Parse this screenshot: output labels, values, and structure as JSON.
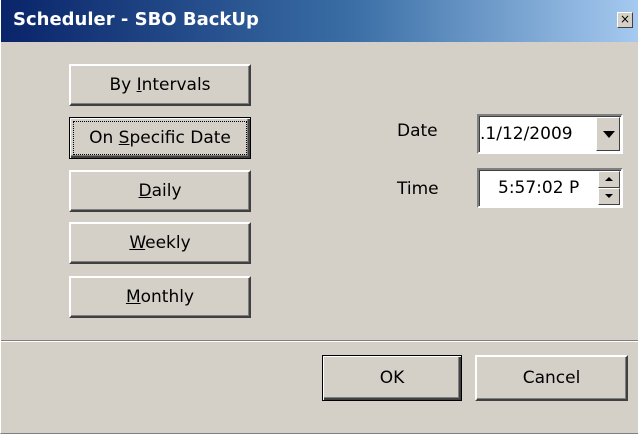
{
  "window": {
    "title": "Scheduler - SBO BackUp",
    "close_glyph": "×"
  },
  "schedule_buttons": [
    {
      "pre": "By ",
      "accel": "I",
      "post": "ntervals"
    },
    {
      "pre": "On ",
      "accel": "S",
      "post": "pecific Date"
    },
    {
      "pre": "",
      "accel": "D",
      "post": "aily"
    },
    {
      "pre": "",
      "accel": "W",
      "post": "eekly"
    },
    {
      "pre": "",
      "accel": "M",
      "post": "onthly"
    }
  ],
  "date": {
    "label": "Date",
    "value": ".1/12/2009"
  },
  "time": {
    "label": "Time",
    "value": "5:57:02 P"
  },
  "footer": {
    "ok_label": "OK",
    "cancel_label": "Cancel"
  },
  "icons": {
    "date_dropdown": "chevron-down-icon",
    "spin_up": "spin-up-icon",
    "spin_down": "spin-down-icon",
    "close": "close-icon"
  }
}
